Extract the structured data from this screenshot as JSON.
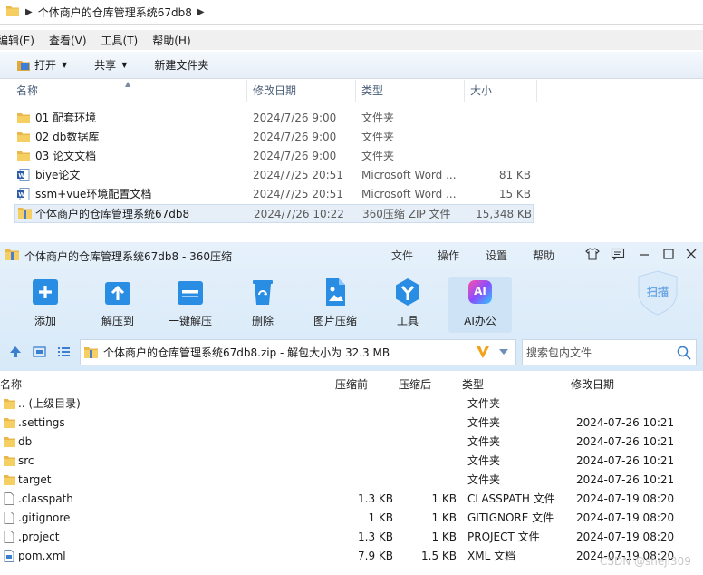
{
  "explorer": {
    "breadcrumb": "个体商户的仓库管理系统67db8",
    "menu": [
      "编辑(E)",
      "查看(V)",
      "工具(T)",
      "帮助(H)"
    ],
    "toolbar": {
      "open": "打开",
      "share": "共享",
      "new_folder": "新建文件夹"
    },
    "columns": {
      "name": "名称",
      "date": "修改日期",
      "type": "类型",
      "size": "大小"
    },
    "files": [
      {
        "icon": "folder-icon",
        "name": "01 配套环境",
        "date": "2024/7/26 9:00",
        "type": "文件夹",
        "size": ""
      },
      {
        "icon": "folder-icon",
        "name": "02 db数据库",
        "date": "2024/7/26 9:00",
        "type": "文件夹",
        "size": ""
      },
      {
        "icon": "folder-icon",
        "name": "03 论文文档",
        "date": "2024/7/26 9:00",
        "type": "文件夹",
        "size": ""
      },
      {
        "icon": "word-doc-icon",
        "name": "biye论文",
        "date": "2024/7/25 20:51",
        "type": "Microsoft Word ...",
        "size": "81 KB"
      },
      {
        "icon": "word-doc-icon",
        "name": "ssm+vue环境配置文档",
        "date": "2024/7/25 20:51",
        "type": "Microsoft Word ...",
        "size": "15 KB"
      },
      {
        "icon": "zip-archive-icon",
        "name": "个体商户的仓库管理系统67db8",
        "date": "2024/7/26 10:22",
        "type": "360压缩 ZIP 文件",
        "size": "15,348 KB",
        "selected": true
      }
    ]
  },
  "zip": {
    "title": "个体商户的仓库管理系统67db8 - 360压缩",
    "menu": [
      "文件",
      "操作",
      "设置",
      "帮助"
    ],
    "ribbon": [
      "添加",
      "解压到",
      "一键解压",
      "删除",
      "图片压缩",
      "工具",
      "AI办公"
    ],
    "ai_icon_text": "AI",
    "scan_label": "扫描",
    "path": "个体商户的仓库管理系统67db8.zip - 解包大小为 32.3 MB",
    "search_placeholder": "搜索包内文件",
    "columns": {
      "name": "名称",
      "compressed": "压缩前",
      "packed": "压缩后",
      "type": "类型",
      "date": "修改日期"
    },
    "rows": [
      {
        "icon": "folder-icon",
        "name": ".. (上级目录)",
        "compressed": "",
        "packed": "",
        "type": "文件夹",
        "date": ""
      },
      {
        "icon": "folder-icon",
        "name": ".settings",
        "compressed": "",
        "packed": "",
        "type": "文件夹",
        "date": "2024-07-26 10:21"
      },
      {
        "icon": "folder-icon",
        "name": "db",
        "compressed": "",
        "packed": "",
        "type": "文件夹",
        "date": "2024-07-26 10:21"
      },
      {
        "icon": "folder-icon",
        "name": "src",
        "compressed": "",
        "packed": "",
        "type": "文件夹",
        "date": "2024-07-26 10:21"
      },
      {
        "icon": "folder-icon",
        "name": "target",
        "compressed": "",
        "packed": "",
        "type": "文件夹",
        "date": "2024-07-26 10:21"
      },
      {
        "icon": "file-icon",
        "name": ".classpath",
        "compressed": "1.3 KB",
        "packed": "1 KB",
        "type": "CLASSPATH 文件",
        "date": "2024-07-19 08:20"
      },
      {
        "icon": "file-icon",
        "name": ".gitignore",
        "compressed": "1 KB",
        "packed": "1 KB",
        "type": "GITIGNORE 文件",
        "date": "2024-07-19 08:20"
      },
      {
        "icon": "file-icon",
        "name": ".project",
        "compressed": "1.3 KB",
        "packed": "1 KB",
        "type": "PROJECT 文件",
        "date": "2024-07-19 08:20"
      },
      {
        "icon": "xml-file-icon",
        "name": "pom.xml",
        "compressed": "7.9 KB",
        "packed": "1.5 KB",
        "type": "XML 文档",
        "date": "2024-07-19 08:20"
      }
    ]
  },
  "watermark": "CSDN @shejl309"
}
